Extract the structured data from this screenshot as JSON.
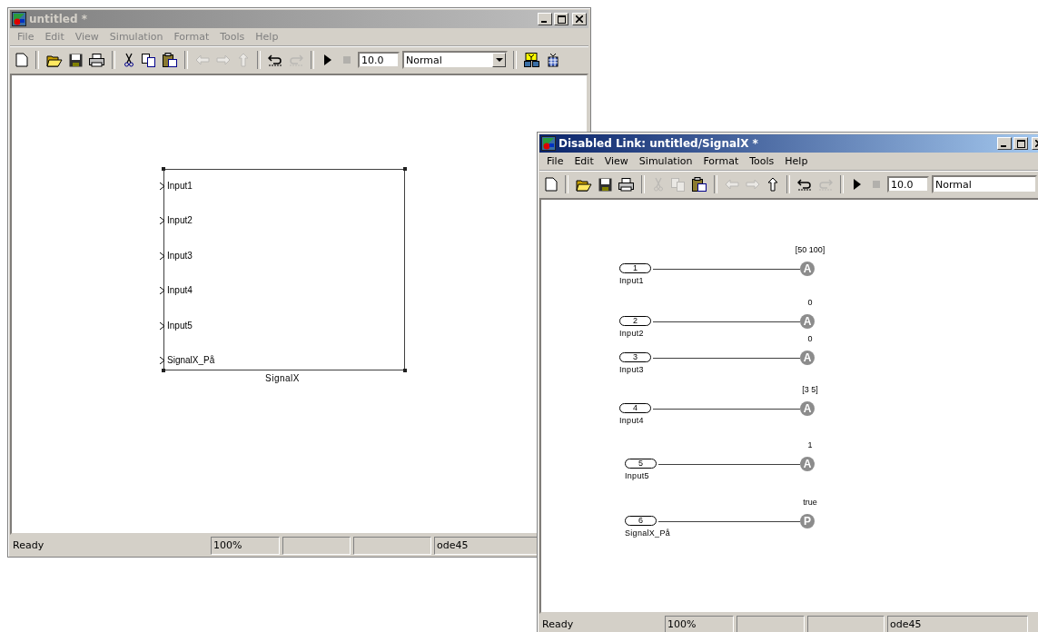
{
  "windows": [
    {
      "title": "untitled *",
      "active": false,
      "menu": [
        "File",
        "Edit",
        "View",
        "Simulation",
        "Format",
        "Tools",
        "Help"
      ],
      "toolbar": [
        {
          "kind": "new",
          "disabled": false
        },
        {
          "kind": "separator"
        },
        {
          "kind": "open",
          "disabled": false
        },
        {
          "kind": "save",
          "disabled": false
        },
        {
          "kind": "print",
          "disabled": false
        },
        {
          "kind": "separator"
        },
        {
          "kind": "cut",
          "disabled": false
        },
        {
          "kind": "copy",
          "disabled": false
        },
        {
          "kind": "paste",
          "disabled": false
        },
        {
          "kind": "separator"
        },
        {
          "kind": "back",
          "disabled": true
        },
        {
          "kind": "forward",
          "disabled": true
        },
        {
          "kind": "up",
          "disabled": true
        },
        {
          "kind": "separator"
        },
        {
          "kind": "undo",
          "disabled": false
        },
        {
          "kind": "redo",
          "disabled": true
        },
        {
          "kind": "separator"
        },
        {
          "kind": "start",
          "disabled": false
        },
        {
          "kind": "stop",
          "disabled": true
        },
        {
          "kind": "stop_time",
          "value": "10.0"
        },
        {
          "kind": "mode",
          "value": "Normal"
        },
        {
          "kind": "separator"
        },
        {
          "kind": "library",
          "disabled": false
        },
        {
          "kind": "debug",
          "disabled": false
        }
      ],
      "diagram": {
        "kind": "subsystem",
        "name": "SignalX",
        "ports": [
          "Input1",
          "Input2",
          "Input3",
          "Input4",
          "Input5",
          "SignalX_På"
        ]
      },
      "status_bar": {
        "message": "Ready",
        "zoom": "100%",
        "solver": "ode45"
      }
    },
    {
      "title": "Disabled Link: untitled/SignalX *",
      "active": true,
      "menu": [
        "File",
        "Edit",
        "View",
        "Simulation",
        "Format",
        "Tools",
        "Help"
      ],
      "toolbar": [
        {
          "kind": "new",
          "disabled": false
        },
        {
          "kind": "separator"
        },
        {
          "kind": "open",
          "disabled": false
        },
        {
          "kind": "save",
          "disabled": false
        },
        {
          "kind": "print",
          "disabled": false
        },
        {
          "kind": "separator"
        },
        {
          "kind": "cut",
          "disabled": true
        },
        {
          "kind": "copy",
          "disabled": true
        },
        {
          "kind": "paste",
          "disabled": false
        },
        {
          "kind": "separator"
        },
        {
          "kind": "back",
          "disabled": true
        },
        {
          "kind": "forward",
          "disabled": true
        },
        {
          "kind": "up",
          "disabled": false
        },
        {
          "kind": "separator"
        },
        {
          "kind": "undo",
          "disabled": false
        },
        {
          "kind": "redo",
          "disabled": true
        },
        {
          "kind": "separator"
        },
        {
          "kind": "start",
          "disabled": false
        },
        {
          "kind": "stop",
          "disabled": true
        },
        {
          "kind": "stop_time",
          "value": "10.0"
        },
        {
          "kind": "mode",
          "value": "Normal"
        }
      ],
      "diagram": {
        "kind": "ports",
        "rows": [
          {
            "number": "1",
            "label": "Input1",
            "value": "[50 100]",
            "letter": "A"
          },
          {
            "number": "2",
            "label": "Input2",
            "value": "0",
            "letter": "A"
          },
          {
            "number": "3",
            "label": "Input3",
            "value": "0",
            "letter": "A"
          },
          {
            "number": "4",
            "label": "Input4",
            "value": "[3 5]",
            "letter": "A"
          },
          {
            "number": "5",
            "label": "Input5",
            "value": "1",
            "letter": "A"
          },
          {
            "number": "6",
            "label": "SignalX_På",
            "value": "true",
            "letter": "P"
          }
        ]
      },
      "status_bar": {
        "message": "Ready",
        "zoom": "100%",
        "solver": "ode45"
      }
    }
  ]
}
